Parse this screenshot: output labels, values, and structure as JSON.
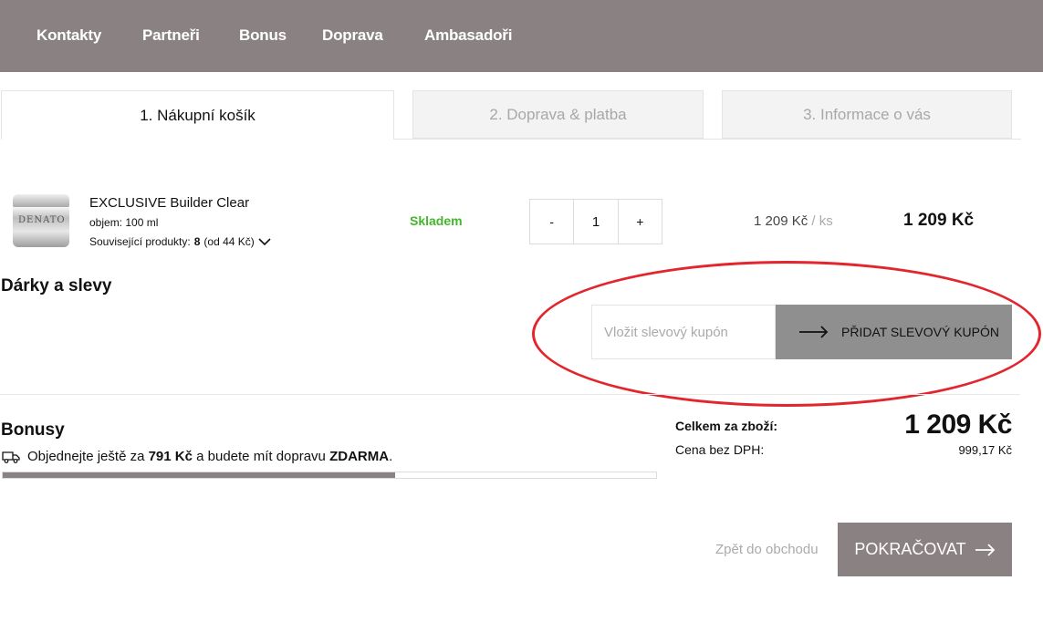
{
  "nav": {
    "items": [
      "Kontakty",
      "Partneři",
      "Bonus",
      "Doprava",
      "Ambasadoři"
    ]
  },
  "steps": [
    {
      "label": "1. Nákupní košík",
      "active": true
    },
    {
      "label": "2. Doprava & platba",
      "active": false
    },
    {
      "label": "3. Informace o vás",
      "active": false
    }
  ],
  "cart_item": {
    "image_brand": "DENATO",
    "name": "EXCLUSIVE Builder Clear",
    "volume": "objem: 100 ml",
    "related_label": "Související produkty:",
    "related_count": "8",
    "related_from": "(od 44 Kč)",
    "availability": "Skladem",
    "qty_minus": "-",
    "qty": "1",
    "qty_plus": "+",
    "unit_price": "1 209 Kč",
    "unit_suffix": "/ ks",
    "line_total": "1 209 Kč"
  },
  "gifts": {
    "heading": "Dárky a slevy",
    "coupon_placeholder": "Vložit slevový kupón",
    "coupon_button": "PŘIDAT SLEVOVÝ KUPÓN"
  },
  "bonus": {
    "heading": "Bonusy",
    "text_before": "Objednejte ještě za",
    "amount": "791 Kč",
    "text_middle": "a budete mít dopravu",
    "free": "ZDARMA",
    "text_end": ".",
    "progress_fraction": 0.6
  },
  "totals": {
    "total_label": "Celkem za zboží:",
    "total_value": "1 209 Kč",
    "net_label": "Cena bez DPH:",
    "net_value": "999,17 Kč"
  },
  "footer": {
    "back_label": "Zpět do obchodu",
    "continue_label": "POKRAČOVAT"
  },
  "colors": {
    "brand": "#8a8182",
    "in_stock": "#42b72a",
    "highlight_ellipse": "#e3252d"
  }
}
